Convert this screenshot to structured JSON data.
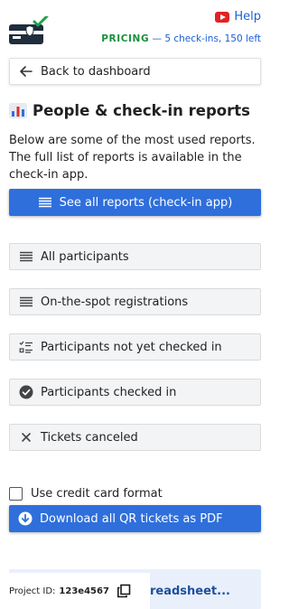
{
  "header": {
    "logo_icon": "ticket-check-icon",
    "help_icon": "youtube-icon",
    "help_label": "Help",
    "pricing_label": "PRICING",
    "pricing_detail": "— 5 check-ins, 150 left",
    "colors": {
      "link": "#1a5fd6",
      "pricing": "#19913b"
    }
  },
  "nav": {
    "back_icon": "arrow-left-icon",
    "back_label": "Back to dashboard"
  },
  "section": {
    "icon": "bar-chart-icon",
    "title": "People & check-in reports",
    "description": "Below are some of the most used reports. The full list of reports is available in the check-in app."
  },
  "primary": {
    "icon": "list-icon",
    "label": "See all reports (check-in app)",
    "color": "#2f6fdc"
  },
  "reports": [
    {
      "icon": "list-icon",
      "label": "All participants"
    },
    {
      "icon": "list-icon",
      "label": "On-the-spot registrations"
    },
    {
      "icon": "checklist-icon",
      "label": "Participants not yet checked in"
    },
    {
      "icon": "check-circle-icon",
      "label": "Participants checked in"
    },
    {
      "icon": "close-icon",
      "label": "Tickets canceled"
    }
  ],
  "export": {
    "checkbox_label": "Use credit card format",
    "checkbox_checked": false,
    "download_icon": "download-icon",
    "download_label": "Download all QR tickets as PDF"
  },
  "footer": {
    "sheet_label": "readsheet...",
    "project_key": "Project ID:",
    "project_value": "123e4567",
    "copy_icon": "copy-icon"
  }
}
